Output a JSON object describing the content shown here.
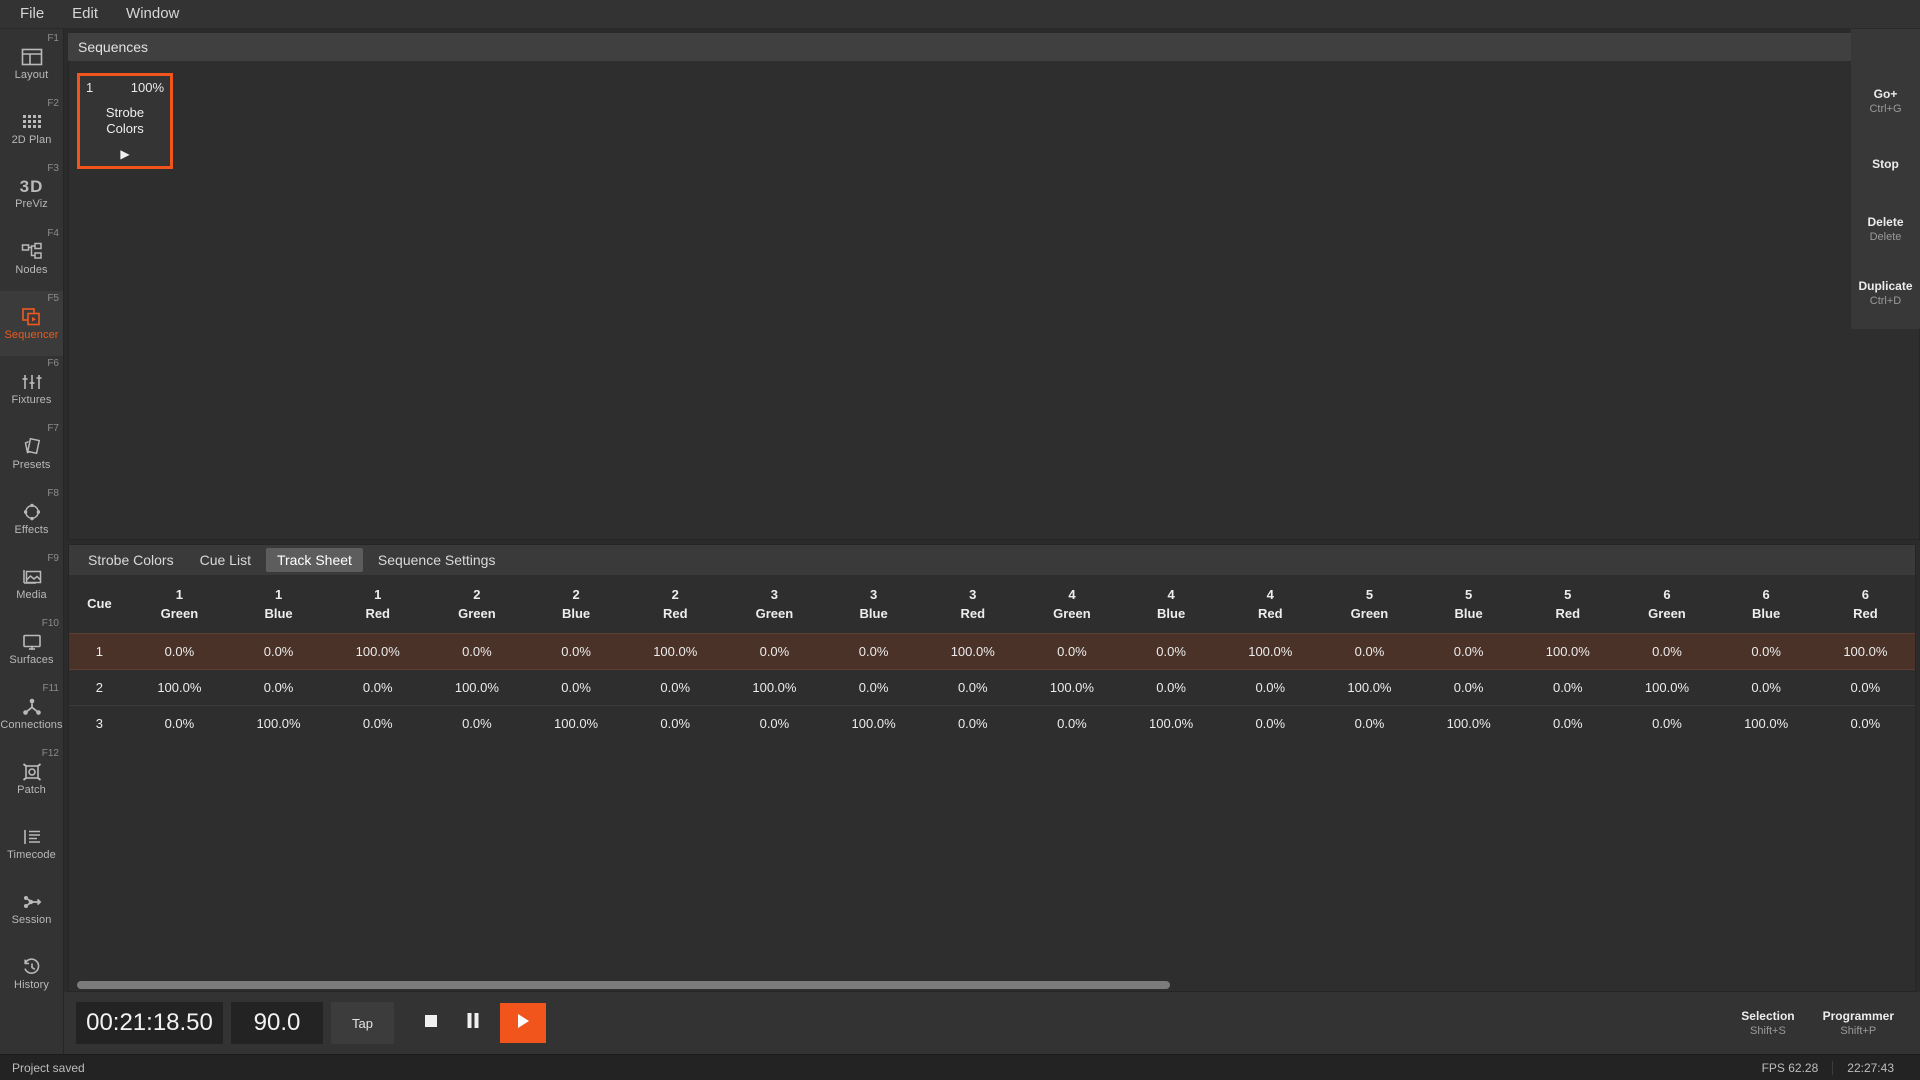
{
  "menubar": {
    "items": [
      {
        "label": "File"
      },
      {
        "label": "Edit"
      },
      {
        "label": "Window"
      }
    ]
  },
  "rail": {
    "items": [
      {
        "label": "Layout",
        "fkey": "F1",
        "icon": "layout-icon"
      },
      {
        "label": "2D Plan",
        "fkey": "F2",
        "icon": "grid-icon"
      },
      {
        "label": "PreViz",
        "fkey": "F3",
        "icon": "3d-icon"
      },
      {
        "label": "Nodes",
        "fkey": "F4",
        "icon": "nodes-icon"
      },
      {
        "label": "Sequencer",
        "fkey": "F5",
        "icon": "sequencer-icon"
      },
      {
        "label": "Fixtures",
        "fkey": "F6",
        "icon": "faders-icon"
      },
      {
        "label": "Presets",
        "fkey": "F7",
        "icon": "presets-icon"
      },
      {
        "label": "Effects",
        "fkey": "F8",
        "icon": "effects-icon"
      },
      {
        "label": "Media",
        "fkey": "F9",
        "icon": "media-icon"
      },
      {
        "label": "Surfaces",
        "fkey": "F10",
        "icon": "surfaces-icon"
      },
      {
        "label": "Connections",
        "fkey": "F11",
        "icon": "connections-icon"
      },
      {
        "label": "Patch",
        "fkey": "F12",
        "icon": "patch-icon"
      },
      {
        "label": "Timecode",
        "fkey": "",
        "icon": "timecode-icon"
      },
      {
        "label": "Session",
        "fkey": "",
        "icon": "session-icon"
      },
      {
        "label": "History",
        "fkey": "",
        "icon": "history-icon"
      }
    ]
  },
  "sequences_panel": {
    "title": "Sequences",
    "search_icon": "search-icon",
    "cards": [
      {
        "number": "1",
        "intensity": "100%",
        "name_line1": "Strobe",
        "name_line2": "Colors",
        "play_glyph": "▶",
        "selected": true
      }
    ]
  },
  "command_panel": {
    "buttons": [
      {
        "label": "Go+",
        "shortcut": "Ctrl+G"
      },
      {
        "label": "Stop",
        "shortcut": ""
      },
      {
        "label": "Delete",
        "shortcut": "Delete"
      },
      {
        "label": "Duplicate",
        "shortcut": "Ctrl+D"
      }
    ]
  },
  "dock": {
    "tabs": [
      {
        "label": "Strobe Colors",
        "active": false
      },
      {
        "label": "Cue List",
        "active": false
      },
      {
        "label": "Track Sheet",
        "active": true
      },
      {
        "label": "Sequence Settings",
        "active": false
      }
    ]
  },
  "track_sheet": {
    "cue_header": "Cue",
    "columns": [
      {
        "num": "1",
        "color": "Green"
      },
      {
        "num": "1",
        "color": "Blue"
      },
      {
        "num": "1",
        "color": "Red"
      },
      {
        "num": "2",
        "color": "Green"
      },
      {
        "num": "2",
        "color": "Blue"
      },
      {
        "num": "2",
        "color": "Red"
      },
      {
        "num": "3",
        "color": "Green"
      },
      {
        "num": "3",
        "color": "Blue"
      },
      {
        "num": "3",
        "color": "Red"
      },
      {
        "num": "4",
        "color": "Green"
      },
      {
        "num": "4",
        "color": "Blue"
      },
      {
        "num": "4",
        "color": "Red"
      },
      {
        "num": "5",
        "color": "Green"
      },
      {
        "num": "5",
        "color": "Blue"
      },
      {
        "num": "5",
        "color": "Red"
      },
      {
        "num": "6",
        "color": "Green"
      },
      {
        "num": "6",
        "color": "Blue"
      },
      {
        "num": "6",
        "color": "Red"
      }
    ],
    "rows": [
      {
        "cue": "1",
        "selected": true,
        "values": [
          "0.0%",
          "0.0%",
          "100.0%",
          "0.0%",
          "0.0%",
          "100.0%",
          "0.0%",
          "0.0%",
          "100.0%",
          "0.0%",
          "0.0%",
          "100.0%",
          "0.0%",
          "0.0%",
          "100.0%",
          "0.0%",
          "0.0%",
          "100.0%"
        ]
      },
      {
        "cue": "2",
        "selected": false,
        "values": [
          "100.0%",
          "0.0%",
          "0.0%",
          "100.0%",
          "0.0%",
          "0.0%",
          "100.0%",
          "0.0%",
          "0.0%",
          "100.0%",
          "0.0%",
          "0.0%",
          "100.0%",
          "0.0%",
          "0.0%",
          "100.0%",
          "0.0%",
          "0.0%"
        ]
      },
      {
        "cue": "3",
        "selected": false,
        "values": [
          "0.0%",
          "100.0%",
          "0.0%",
          "0.0%",
          "100.0%",
          "0.0%",
          "0.0%",
          "100.0%",
          "0.0%",
          "0.0%",
          "100.0%",
          "0.0%",
          "0.0%",
          "100.0%",
          "0.0%",
          "0.0%",
          "100.0%",
          "0.0%"
        ]
      }
    ]
  },
  "transport": {
    "timecode": "00:21:18.50",
    "bpm": "90.0",
    "tap_label": "Tap",
    "stop_icon": "stop-icon",
    "pause_icon": "pause-icon",
    "play_icon": "play-icon",
    "right_buttons": [
      {
        "label": "Selection",
        "shortcut": "Shift+S"
      },
      {
        "label": "Programmer",
        "shortcut": "Shift+P"
      }
    ]
  },
  "statusbar": {
    "message": "Project saved",
    "fps": "FPS 62.28",
    "clock": "22:27:43"
  },
  "colors": {
    "accent": "#f2551b",
    "selected_row": "#4a3228",
    "panel": "#2e2e2e",
    "chrome": "#333333"
  }
}
